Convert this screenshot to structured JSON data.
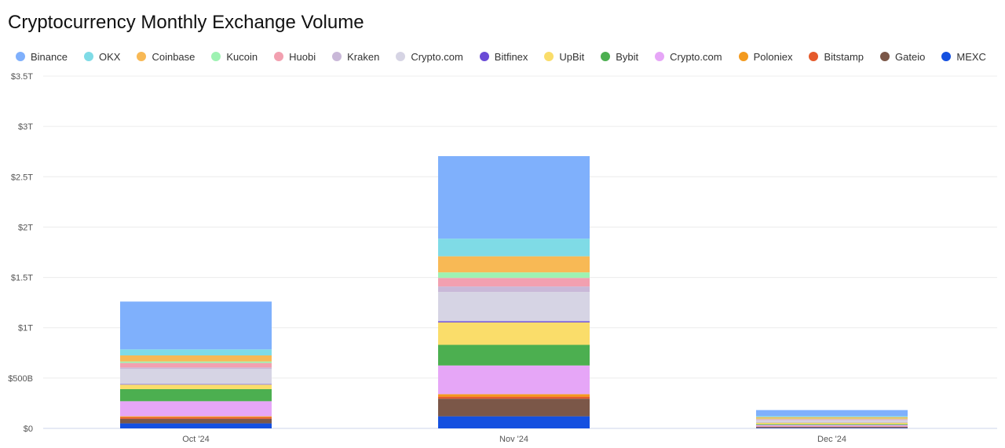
{
  "chart_data": {
    "type": "bar",
    "stacked": true,
    "title": "Cryptocurrency Monthly Exchange Volume",
    "xlabel": "",
    "ylabel": "",
    "categories": [
      "Oct '24",
      "Nov '24",
      "Dec '24"
    ],
    "ylim": [
      0,
      3.5
    ],
    "y_unit": "trillion USD",
    "y_ticks": [
      {
        "value": 0,
        "label": "$0"
      },
      {
        "value": 0.5,
        "label": "$500B"
      },
      {
        "value": 1,
        "label": "$1T"
      },
      {
        "value": 1.5,
        "label": "$1.5T"
      },
      {
        "value": 2,
        "label": "$2T"
      },
      {
        "value": 2.5,
        "label": "$2.5T"
      },
      {
        "value": 3,
        "label": "$3T"
      },
      {
        "value": 3.5,
        "label": "$3.5T"
      }
    ],
    "grid": true,
    "legend_position": "top-left",
    "series": [
      {
        "name": "Binance",
        "color": "#7fb0fc",
        "values": [
          0.475,
          0.82,
          0.06
        ]
      },
      {
        "name": "OKX",
        "color": "#7fdbe6",
        "values": [
          0.06,
          0.175,
          0.01
        ]
      },
      {
        "name": "Coinbase",
        "color": "#f8b955",
        "values": [
          0.06,
          0.16,
          0.015
        ]
      },
      {
        "name": "Kucoin",
        "color": "#9ef2b2",
        "values": [
          0.015,
          0.055,
          0.005
        ]
      },
      {
        "name": "Huobi",
        "color": "#f2a0b0",
        "values": [
          0.045,
          0.085,
          0.008
        ]
      },
      {
        "name": "Kraken",
        "color": "#c9b8d8",
        "values": [
          0.015,
          0.055,
          0.005
        ]
      },
      {
        "name": "Crypto.com",
        "color": "#d6d4e4",
        "values": [
          0.15,
          0.29,
          0.02
        ]
      },
      {
        "name": "Bitfinex",
        "color": "#6a4bd6",
        "values": [
          0.005,
          0.012,
          0.002
        ]
      },
      {
        "name": "UpBit",
        "color": "#fadd6a",
        "values": [
          0.045,
          0.223,
          0.015
        ]
      },
      {
        "name": "Bybit",
        "color": "#4caf50",
        "values": [
          0.12,
          0.205,
          0.008
        ]
      },
      {
        "name": "Crypto.com",
        "color": "#e6a6f7",
        "values": [
          0.15,
          0.285,
          0.015
        ]
      },
      {
        "name": "Poloniex",
        "color": "#f39a1e",
        "values": [
          0.01,
          0.025,
          0.002
        ]
      },
      {
        "name": "Bitstamp",
        "color": "#e55a2b",
        "values": [
          0.015,
          0.02,
          0.002
        ]
      },
      {
        "name": "Gateio",
        "color": "#7b5748",
        "values": [
          0.045,
          0.175,
          0.01
        ]
      },
      {
        "name": "MEXC",
        "color": "#1450e0",
        "values": [
          0.05,
          0.12,
          0.005
        ]
      }
    ]
  }
}
